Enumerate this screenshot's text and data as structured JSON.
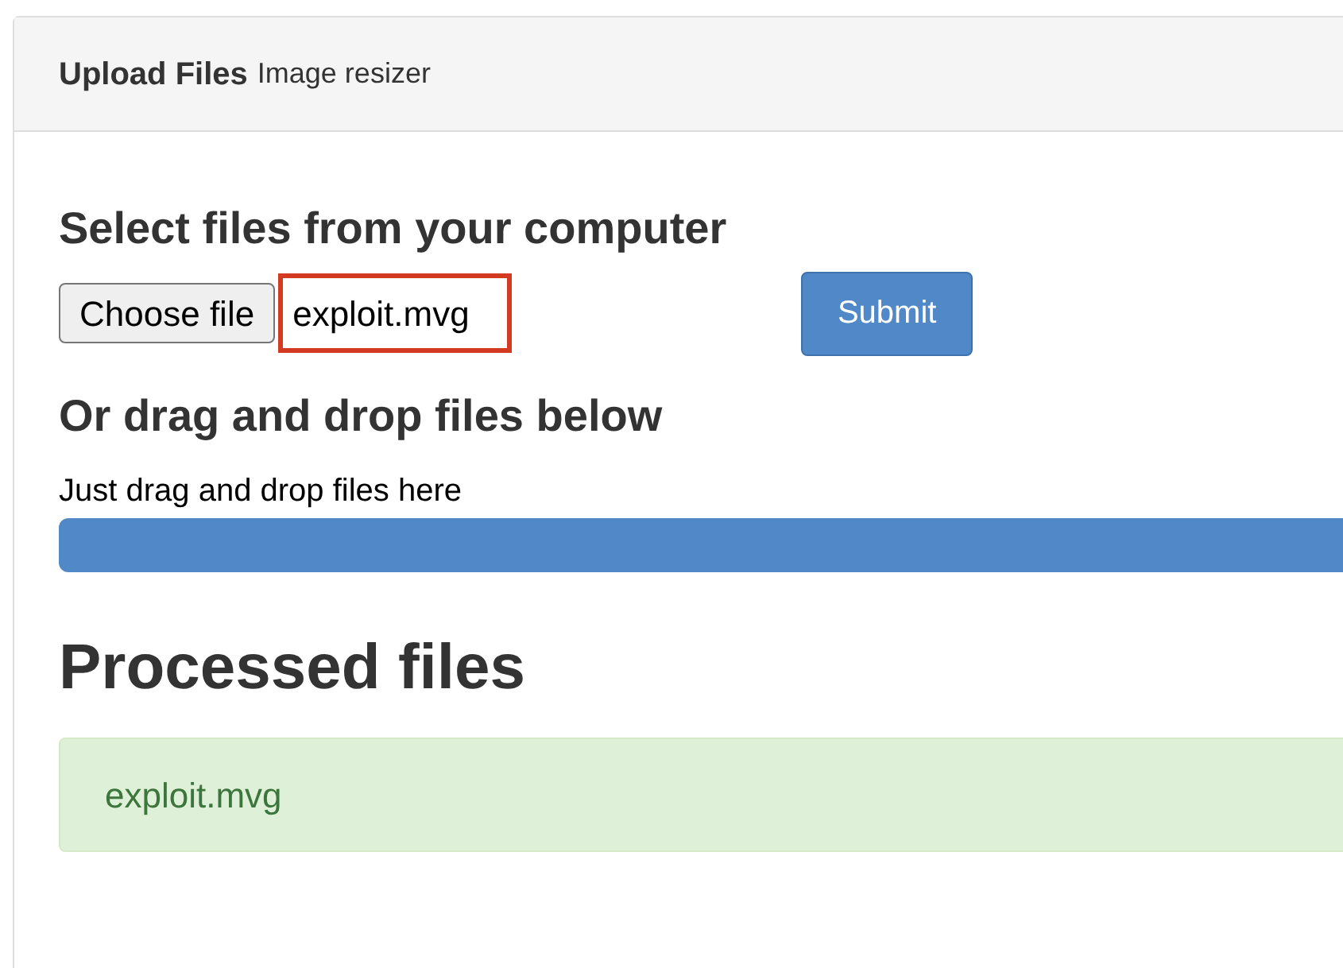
{
  "panel": {
    "title": "Upload Files",
    "subtitle": "Image resizer"
  },
  "upload": {
    "heading": "Select files from your computer",
    "choose_button": "Choose file",
    "file_name": "exploit.mvg",
    "file_name_highlighted": true,
    "submit": "Submit"
  },
  "drop": {
    "heading": "Or drag and drop files below",
    "hint": "Just drag and drop files here",
    "progress": {
      "level": 1
    }
  },
  "processed": {
    "heading": "Processed files",
    "files": [
      {
        "name": "exploit.mvg"
      }
    ]
  }
}
